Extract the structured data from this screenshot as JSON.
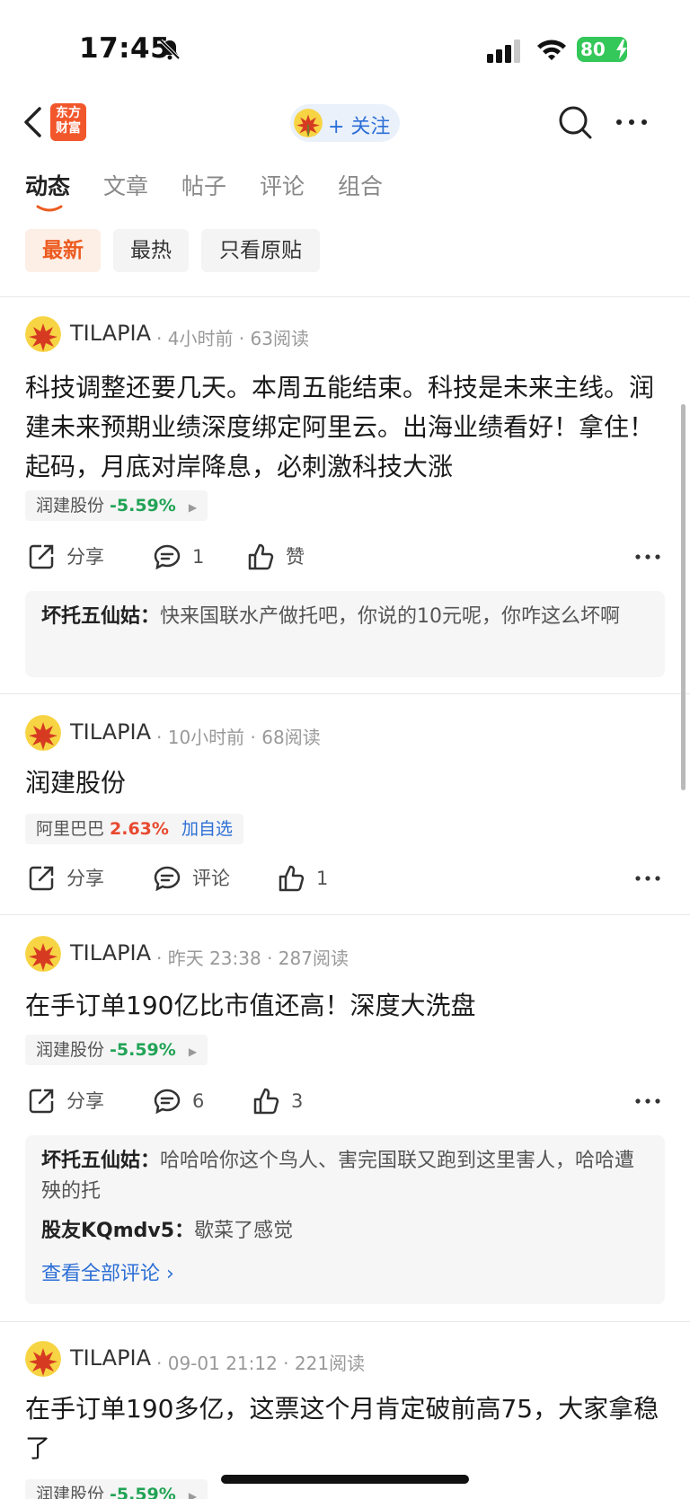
{
  "status_bar": {
    "time": "17:45",
    "battery": "80"
  },
  "header": {
    "brand_line1": "东方",
    "brand_line2": "财富",
    "follow_label": "+ 关注"
  },
  "tabs": [
    "动态",
    "文章",
    "帖子",
    "评论",
    "组合"
  ],
  "filters": [
    "最新",
    "最热",
    "只看原贴"
  ],
  "posts": [
    {
      "author": "TILAPIA",
      "time": "4小时前",
      "reads": "63阅读",
      "content": "科技调整还要几天。本周五能结束。科技是未来主线。润建未来预期业绩深度绑定阿里云。出海业绩看好！拿住！起码，月底对岸降息，必刺激科技大涨",
      "stock": {
        "name": "润建股份",
        "change": "-5.59%"
      },
      "actions": {
        "share": "分享",
        "comment": "1",
        "like": "赞"
      },
      "comments": [
        {
          "user": "坏托五仙姑：",
          "text": "快来国联水产做托吧，你说的10元呢，你咋这么坏啊"
        }
      ]
    },
    {
      "author": "TILAPIA",
      "time": "10小时前",
      "reads": "68阅读",
      "content": "润建股份",
      "stock": {
        "name": "阿里巴巴",
        "change": "2.63%",
        "add": "加自选"
      },
      "actions": {
        "share": "分享",
        "comment": "评论",
        "like": "1"
      }
    },
    {
      "author": "TILAPIA",
      "time": "昨天 23:38",
      "reads": "287阅读",
      "content": "在手订单190亿比市值还高！深度大洗盘",
      "stock": {
        "name": "润建股份",
        "change": "-5.59%"
      },
      "actions": {
        "share": "分享",
        "comment": "6",
        "like": "3"
      },
      "comments": [
        {
          "user": "坏托五仙姑：",
          "text": "哈哈哈你这个鸟人、害完国联又跑到这里害人，哈哈遭殃的托"
        },
        {
          "user": "股友KQmdv5：",
          "text": "歇菜了感觉"
        }
      ],
      "view_all": "查看全部评论 ›"
    },
    {
      "author": "TILAPIA",
      "time": "09-01 21:12",
      "reads": "221阅读",
      "content": "在手订单190多亿，这票这个月肯定破前高75，大家拿稳了",
      "stock": {
        "name": "润建股份",
        "change": "-5.59%"
      }
    }
  ],
  "colors": {
    "accent": "#ec5b20",
    "down": "#21a355",
    "up": "#e8492f",
    "link": "#2d6fd6"
  }
}
